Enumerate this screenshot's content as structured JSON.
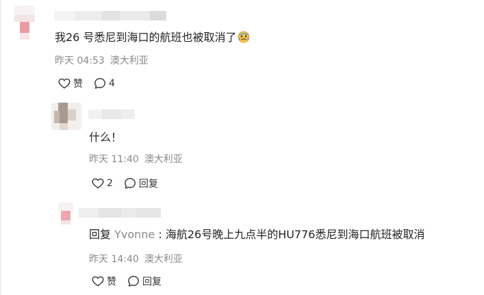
{
  "comments": [
    {
      "text": "我26 号悉尼到海口的航班也被取消了",
      "emoji": "crying-face-emoji",
      "time": "昨天 04:53",
      "location": "澳大利亚",
      "like_label": "赞",
      "reply_count": "4"
    },
    {
      "text": "什么！",
      "time": "昨天 11:40",
      "location": "澳大利亚",
      "like_count": "2",
      "reply_label": "回复"
    },
    {
      "reply_prefix": "回复",
      "reply_target": "Yvonne",
      "reply_sep": " : ",
      "text": "海航26号晚上九点半的HU776悉尼到海口航班被取消",
      "time": "昨天 14:40",
      "location": "澳大利亚",
      "like_label": "赞",
      "reply_label": "回复"
    }
  ],
  "colors": {
    "text": "#222222",
    "meta": "#8a8a8a",
    "icon": "#333333"
  }
}
